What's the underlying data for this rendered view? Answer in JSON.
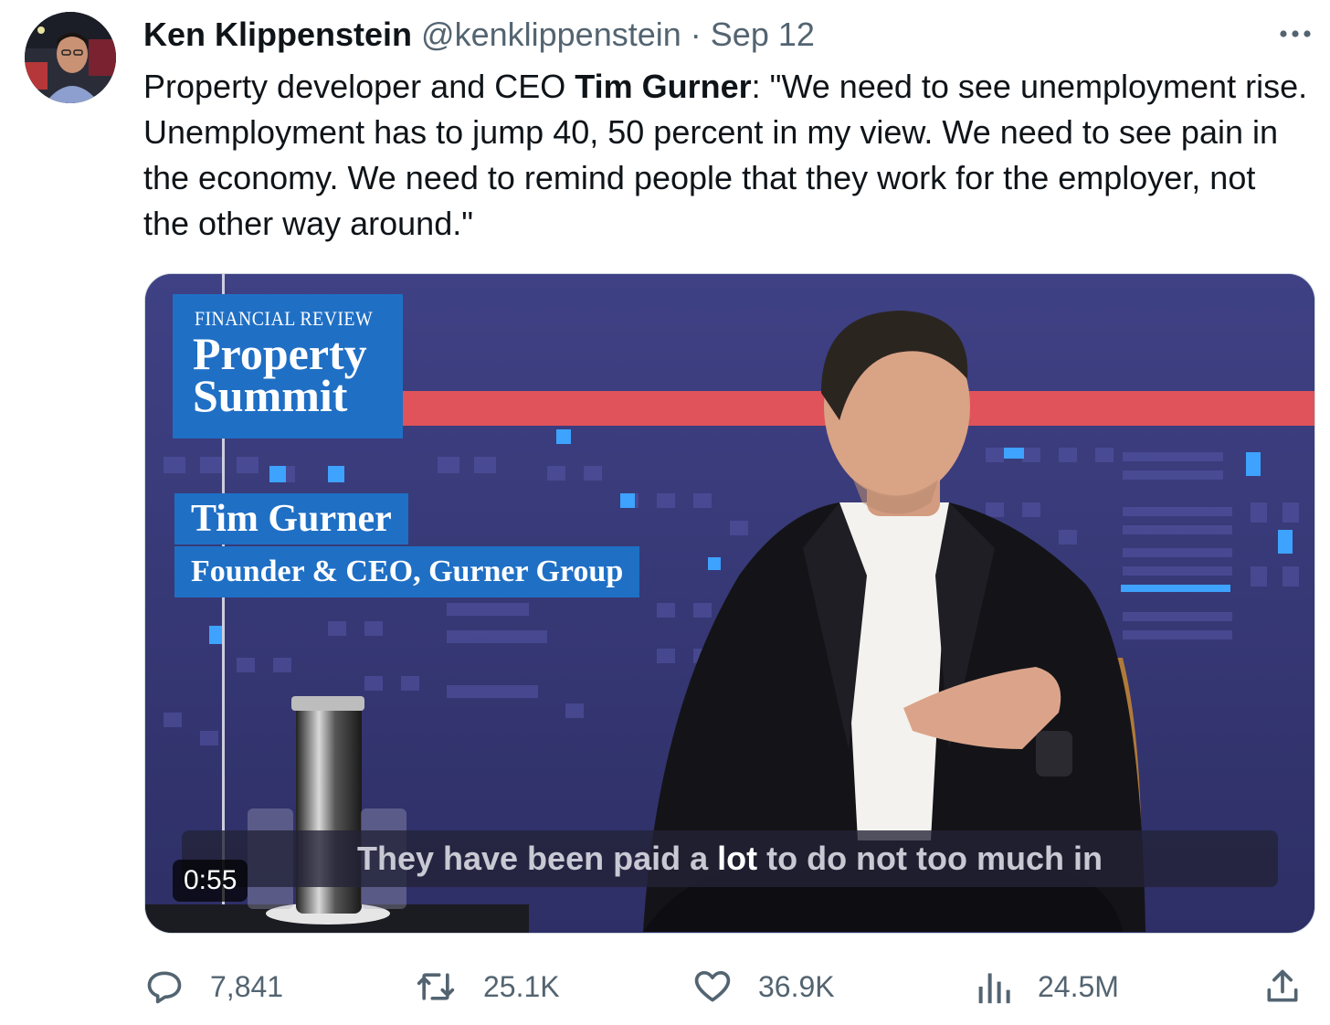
{
  "tweet": {
    "author_name": "Ken Klippenstein",
    "author_handle": "@kenklippenstein",
    "separator": "·",
    "date": "Sep 12",
    "text_part1": "Property developer and CEO ",
    "text_bold": "Tim Gurner",
    "text_part2": ": \"We need to see unemployment rise. Unemployment has to jump 40, 50 percent in my view. We need to see pain in the economy. We need to remind people that they work for the employer, not the other way around.\""
  },
  "media": {
    "brand_kicker": "FINANCIAL REVIEW",
    "brand_title_line1": "Property",
    "brand_title_line2": "Summit",
    "speaker_name": "Tim Gurner",
    "speaker_role": "Founder & CEO, Gurner Group",
    "caption_before": "They have been paid a ",
    "caption_highlight": "lot",
    "caption_after": " to do not too much in",
    "duration": "0:55"
  },
  "actions": {
    "replies": "7,841",
    "retweets": "25.1K",
    "likes": "36.9K",
    "views": "24.5M"
  },
  "icons": {
    "more": "more-horizontal-icon",
    "reply": "reply-bubble-icon",
    "retweet": "retweet-icon",
    "like": "heart-icon",
    "views": "bar-chart-icon",
    "share": "share-upload-icon"
  },
  "colors": {
    "text_primary": "#0f1419",
    "text_secondary": "#536471",
    "stage_background": "#3e3f7e",
    "brand_blue": "#1f6fc5",
    "stage_red_stripe": "#e0535a"
  }
}
